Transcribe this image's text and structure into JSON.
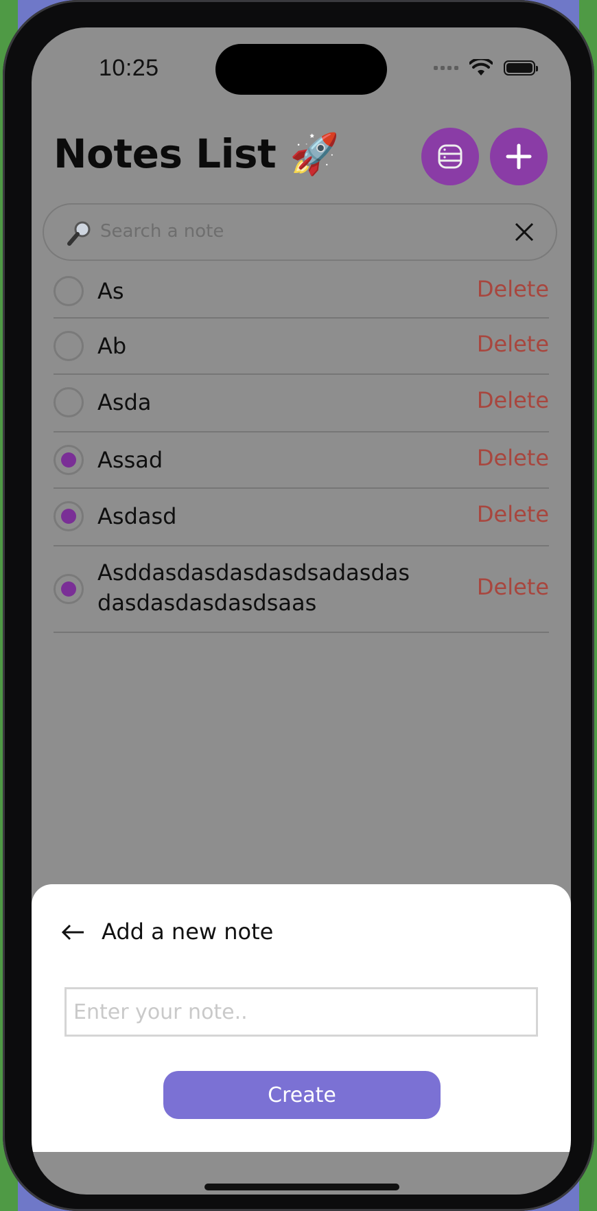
{
  "status": {
    "time": "10:25"
  },
  "header": {
    "title": "Notes List 🚀"
  },
  "search": {
    "placeholder": "Search a note"
  },
  "notes": [
    {
      "text": "As",
      "checked": false,
      "delete_label": "Delete"
    },
    {
      "text": "Ab",
      "checked": false,
      "delete_label": "Delete"
    },
    {
      "text": "Asda",
      "checked": false,
      "delete_label": "Delete"
    },
    {
      "text": "Assad",
      "checked": true,
      "delete_label": "Delete"
    },
    {
      "text": "Asdasd",
      "checked": true,
      "delete_label": "Delete"
    },
    {
      "text": "Asddasdasdasdasdsadasdas dasdasdasdasdsaas",
      "checked": true,
      "delete_label": "Delete"
    }
  ],
  "sheet": {
    "title": "Add a new note",
    "input_placeholder": "Enter your note..",
    "create_label": "Create"
  },
  "colors": {
    "accent": "#8a3ca6",
    "delete": "#a8463e",
    "create": "#7b71d4"
  }
}
